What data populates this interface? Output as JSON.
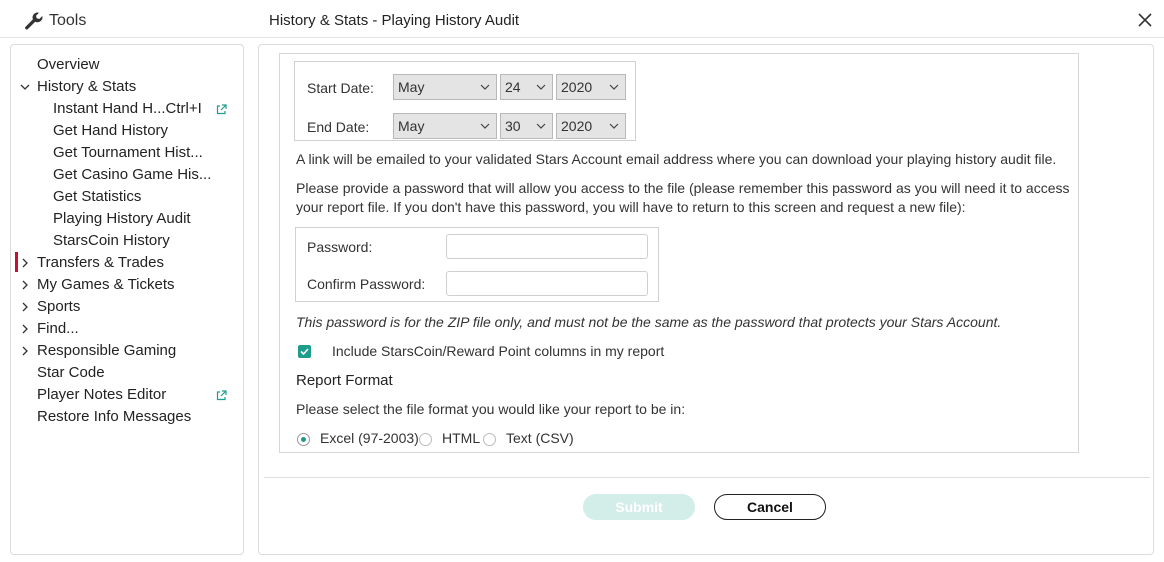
{
  "window": {
    "tools_label": "Tools",
    "title": "History & Stats - Playing History Audit"
  },
  "sidebar": {
    "items": [
      {
        "label": "Overview",
        "chevron": null,
        "external": false
      },
      {
        "label": "History & Stats",
        "chevron": "down",
        "external": false
      },
      {
        "label": "Instant Hand H...Ctrl+I",
        "chevron": null,
        "external": true
      },
      {
        "label": "Get Hand History",
        "chevron": null,
        "external": false
      },
      {
        "label": "Get Tournament Hist...",
        "chevron": null,
        "external": false
      },
      {
        "label": "Get Casino Game His...",
        "chevron": null,
        "external": false
      },
      {
        "label": "Get Statistics",
        "chevron": null,
        "external": false
      },
      {
        "label": "Playing History Audit",
        "chevron": null,
        "external": false,
        "active": true
      },
      {
        "label": "StarsCoin History",
        "chevron": null,
        "external": false
      },
      {
        "label": "Transfers & Trades",
        "chevron": "right",
        "external": false
      },
      {
        "label": "My Games & Tickets",
        "chevron": "right",
        "external": false
      },
      {
        "label": "Sports",
        "chevron": "right",
        "external": false
      },
      {
        "label": "Find...",
        "chevron": "right",
        "external": false
      },
      {
        "label": "Responsible Gaming",
        "chevron": "right",
        "external": false
      },
      {
        "label": "Star Code",
        "chevron": null,
        "external": false
      },
      {
        "label": "Player Notes Editor",
        "chevron": null,
        "external": true
      },
      {
        "label": "Restore Info Messages",
        "chevron": null,
        "external": false
      }
    ]
  },
  "form": {
    "start_date_label": "Start Date:",
    "start_month": "May",
    "start_day": "24",
    "start_year": "2020",
    "end_date_label": "End Date:",
    "end_month": "May",
    "end_day": "30",
    "end_year": "2020",
    "email_note": "A link will be emailed to your validated Stars Account email address where you can download your playing history audit file.",
    "password_note_line1": "Please provide a password that will allow you access to the file (please remember this password as you will need it to access",
    "password_note_line2": "your report file. If you don't have this password, you will have to return to this screen and request a new file):",
    "password_label": "Password:",
    "password_value": "",
    "confirm_password_label": "Confirm Password:",
    "confirm_password_value": "",
    "zip_note": "This password is for the ZIP file only, and must not be the same as the password that protects your Stars Account.",
    "include_columns_label": "Include StarsCoin/Reward Point columns in my report",
    "include_columns_checked": true,
    "report_format_heading": "Report Format",
    "report_format_prompt": "Please select the file format you would like your report to be in:",
    "formats": [
      {
        "label": "Excel (97-2003)",
        "selected": true
      },
      {
        "label": "HTML",
        "selected": false
      },
      {
        "label": "Text (CSV)",
        "selected": false
      }
    ]
  },
  "buttons": {
    "submit": "Submit",
    "cancel": "Cancel"
  },
  "colors": {
    "accent": "#1f9d8b",
    "active_marker": "#c8102e",
    "submit_disabled_bg": "#d3ede9"
  }
}
